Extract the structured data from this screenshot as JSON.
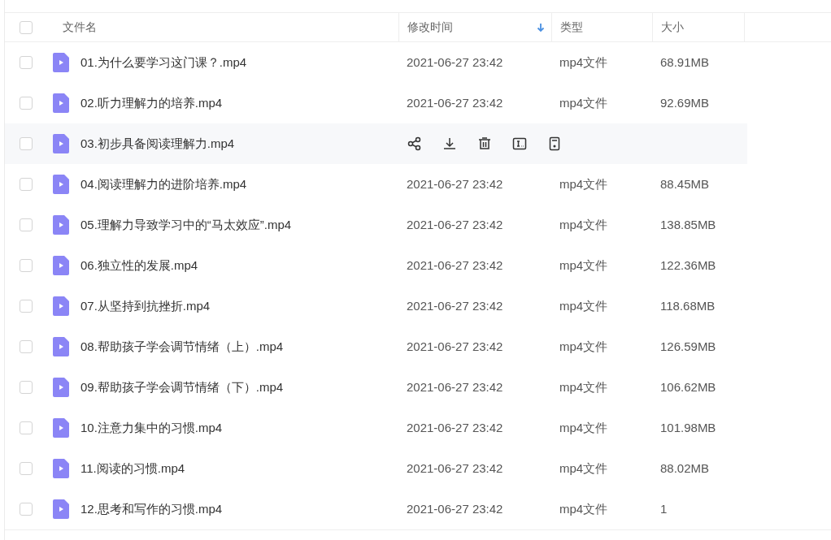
{
  "header": {
    "checked": false,
    "columns": [
      {
        "label": "文件名",
        "sorted": false
      },
      {
        "label": "修改时间",
        "sorted": true
      },
      {
        "label": "类型",
        "sorted": false
      },
      {
        "label": "大小",
        "sorted": false
      }
    ]
  },
  "rows": [
    {
      "checked": false,
      "hovered": false,
      "name": "01.为什么要学习这门课？.mp4",
      "modified": "2021-06-27 23:42",
      "type": "mp4文件",
      "size": "68.91MB"
    },
    {
      "checked": false,
      "hovered": false,
      "name": "02.听力理解力的培养.mp4",
      "modified": "2021-06-27 23:42",
      "type": "mp4文件",
      "size": "92.69MB"
    },
    {
      "checked": false,
      "hovered": true,
      "name": "03.初步具备阅读理解力.mp4",
      "actions": [
        {
          "kind": "share"
        },
        {
          "kind": "download"
        },
        {
          "kind": "delete"
        },
        {
          "kind": "rename"
        },
        {
          "kind": "details"
        }
      ]
    },
    {
      "checked": false,
      "hovered": false,
      "name": "04.阅读理解力的进阶培养.mp4",
      "modified": "2021-06-27 23:42",
      "type": "mp4文件",
      "size": "88.45MB"
    },
    {
      "checked": false,
      "hovered": false,
      "name": "05.理解力导致学习中的“马太效应”.mp4",
      "modified": "2021-06-27 23:42",
      "type": "mp4文件",
      "size": "138.85MB"
    },
    {
      "checked": false,
      "hovered": false,
      "name": "06.独立性的发展.mp4",
      "modified": "2021-06-27 23:42",
      "type": "mp4文件",
      "size": "122.36MB"
    },
    {
      "checked": false,
      "hovered": false,
      "name": "07.从坚持到抗挫折.mp4",
      "modified": "2021-06-27 23:42",
      "type": "mp4文件",
      "size": "118.68MB"
    },
    {
      "checked": false,
      "hovered": false,
      "name": "08.帮助孩子学会调节情绪（上）.mp4",
      "modified": "2021-06-27 23:42",
      "type": "mp4文件",
      "size": "126.59MB"
    },
    {
      "checked": false,
      "hovered": false,
      "name": "09.帮助孩子学会调节情绪（下）.mp4",
      "modified": "2021-06-27 23:42",
      "type": "mp4文件",
      "size": "106.62MB"
    },
    {
      "checked": false,
      "hovered": false,
      "name": "10.注意力集中的习惯.mp4",
      "modified": "2021-06-27 23:42",
      "type": "mp4文件",
      "size": "101.98MB"
    },
    {
      "checked": false,
      "hovered": false,
      "name": "11.阅读的习惯.mp4",
      "modified": "2021-06-27 23:42",
      "type": "mp4文件",
      "size": "88.02MB"
    },
    {
      "checked": false,
      "hovered": false,
      "name": "12.思考和写作的习惯.mp4",
      "modified": "2021-06-27 23:42",
      "type": "mp4文件",
      "size": "1"
    }
  ]
}
